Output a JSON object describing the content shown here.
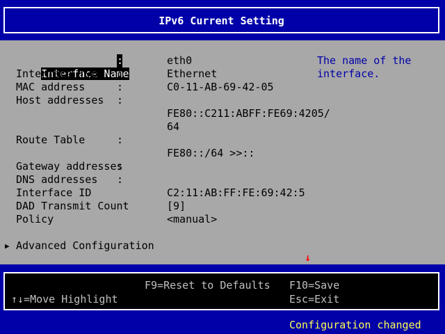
{
  "header": {
    "title": "IPv6 Current Setting"
  },
  "fields": [
    {
      "label": "Interface Name",
      "value": "eth0"
    },
    {
      "label": "Interface Type",
      "value": "Ethernet"
    },
    {
      "label": "MAC address",
      "value": "C0-11-AB-69-42-05"
    },
    {
      "label": "Host addresses",
      "value_lines": [
        "FE80::C211:ABFF:FE69:4205/",
        "64"
      ]
    },
    {
      "label": "Route Table",
      "value": "FE80::/64 >>::"
    },
    {
      "label": "Gateway addresses",
      "value": ""
    },
    {
      "label": "DNS addresses",
      "value": ""
    },
    {
      "label": "Interface ID",
      "value": "C2:11:AB:FF:FE:69:42:5"
    },
    {
      "label": "DAD Transmit Count",
      "value": "[9]"
    },
    {
      "label": "Policy",
      "value": "<manual>"
    }
  ],
  "colon": ":",
  "help": {
    "lines": [
      "The name of the",
      "interface."
    ]
  },
  "advanced": {
    "marker": "▶",
    "label": "Advanced Configuration"
  },
  "scroll_indicator": "↓",
  "footer": {
    "reset": "F9=Reset to Defaults",
    "save": "F10=Save",
    "move": "↑↓=Move Highlight",
    "exit": "Esc=Exit"
  },
  "status": "Configuration changed",
  "colors": {
    "background": "#0000a8",
    "panel": "#a8a8a8",
    "highlight_bg": "#000000",
    "help_text": "#0000a8",
    "status_text": "#ffff54",
    "arrow": "#ff0000"
  }
}
